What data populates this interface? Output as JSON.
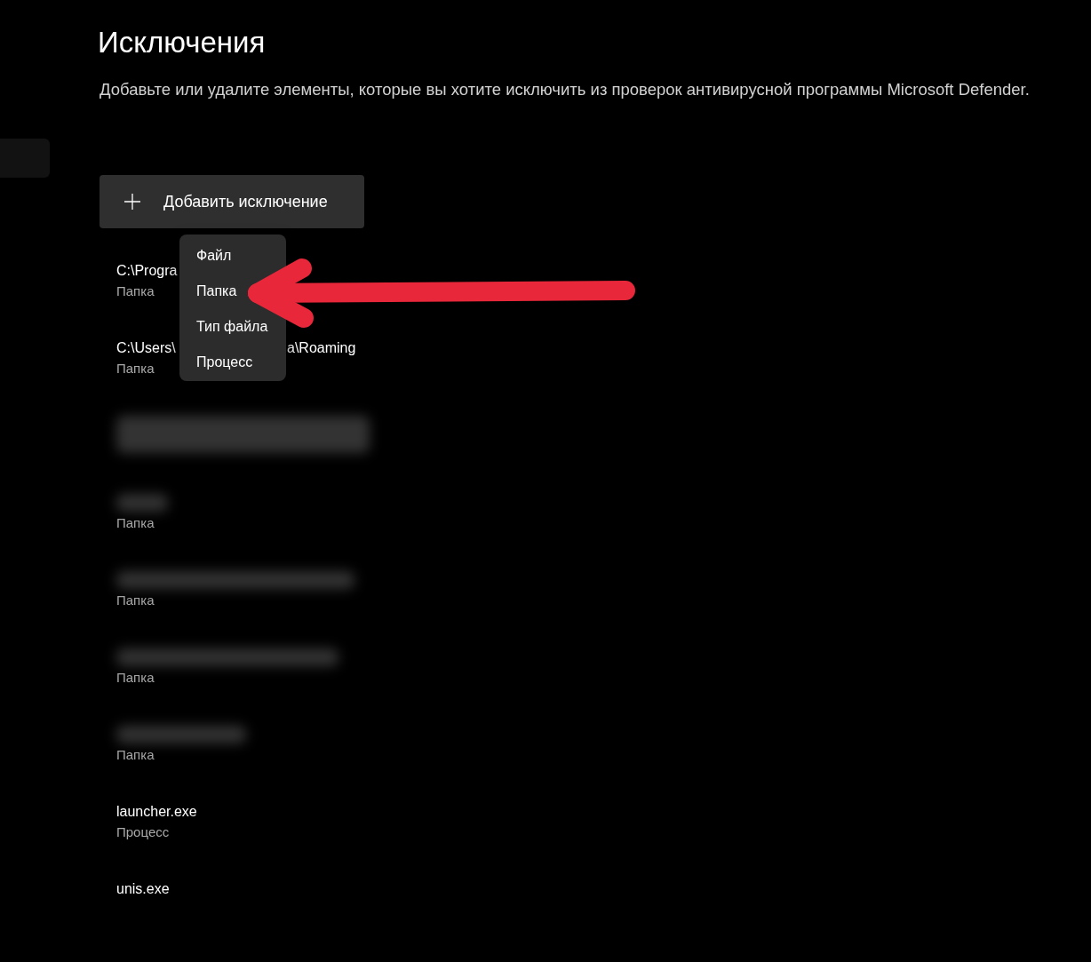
{
  "sidebar": {
    "items": [
      {
        "selected": true
      }
    ]
  },
  "page": {
    "title": "Исключения",
    "description": "Добавьте или удалите элементы, которые вы хотите исключить из проверок антивирусной программы Microsoft Defender."
  },
  "add_button": {
    "label": "Добавить исключение"
  },
  "add_menu": {
    "open": true,
    "items": [
      {
        "label": "Файл",
        "arrow_pointing": false
      },
      {
        "label": "Папка",
        "arrow_pointing": true
      },
      {
        "label": "Тип файла",
        "arrow_pointing": false
      },
      {
        "label": "Процесс",
        "arrow_pointing": false
      }
    ]
  },
  "exclusions": [
    {
      "kind": "entry",
      "path": "C:\\Progra",
      "type": "Папка"
    },
    {
      "kind": "entry",
      "path": "C:\\Users\\",
      "path_end": "a\\Roaming",
      "type": "Папка"
    },
    {
      "kind": "redacted"
    },
    {
      "kind": "path_redacted",
      "type": "Папка"
    },
    {
      "kind": "path_redacted",
      "type": "Папка"
    },
    {
      "kind": "path_redacted",
      "type": "Папка"
    },
    {
      "kind": "path_redacted",
      "type": "Папка"
    },
    {
      "kind": "entry",
      "path": "launcher.exe",
      "type": "Процесс"
    },
    {
      "kind": "entry",
      "path": "unis.exe"
    }
  ]
}
